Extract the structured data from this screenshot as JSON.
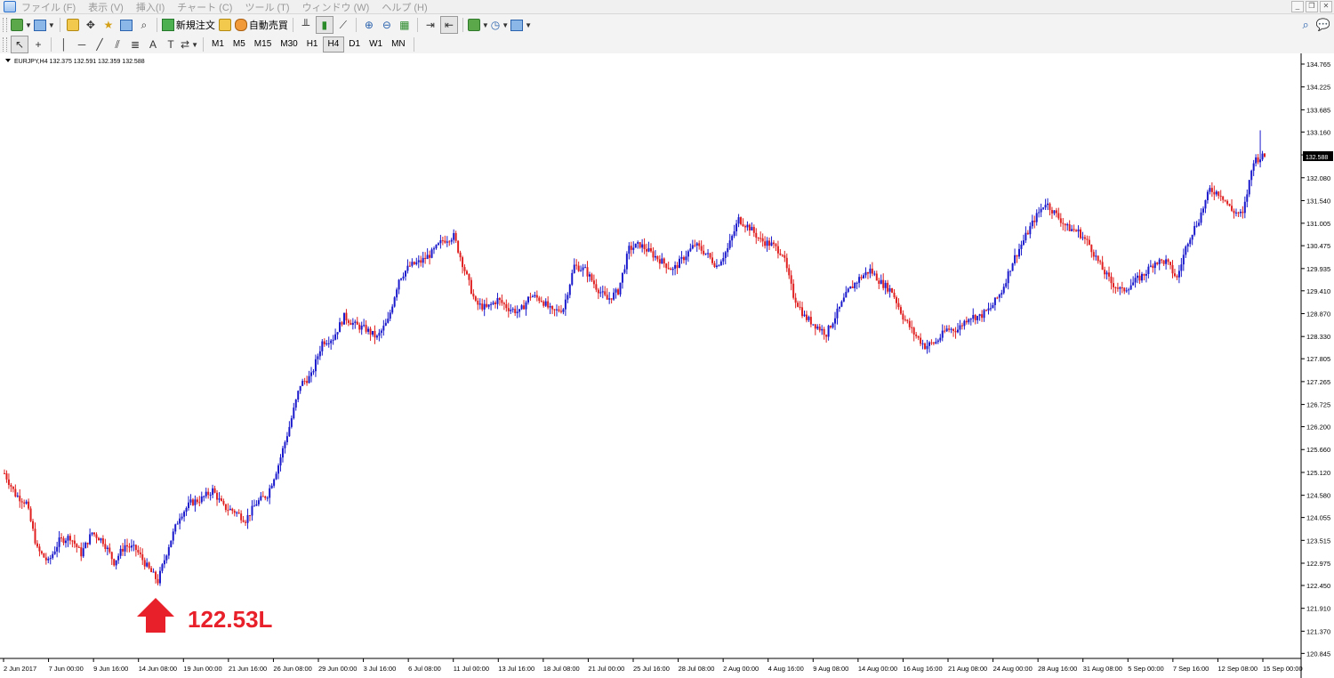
{
  "menu": {
    "items": [
      "ファイル (F)",
      "表示 (V)",
      "挿入(I)",
      "チャート (C)",
      "ツール (T)",
      "ウィンドウ (W)",
      "ヘルプ (H)"
    ]
  },
  "toolbar": {
    "new_order_label": "新規注文",
    "auto_trade_label": "自動売買"
  },
  "timeframes": [
    "M1",
    "M5",
    "M15",
    "M30",
    "H1",
    "H4",
    "D1",
    "W1",
    "MN"
  ],
  "active_timeframe": "H4",
  "chart_header": "EURJPY,H4  132.375 132.591 132.359 132.588",
  "current_price": "132.588",
  "price_labels": [
    "134.765",
    "134.225",
    "133.685",
    "133.160",
    "132.620",
    "132.080",
    "131.540",
    "131.005",
    "130.475",
    "129.935",
    "129.410",
    "128.870",
    "128.330",
    "127.805",
    "127.265",
    "126.725",
    "126.200",
    "125.660",
    "125.120",
    "124.580",
    "124.055",
    "123.515",
    "122.975",
    "122.450",
    "121.910",
    "121.370",
    "120.845"
  ],
  "time_labels": [
    "2 Jun 2017",
    "7 Jun 00:00",
    "9 Jun 16:00",
    "14 Jun 08:00",
    "19 Jun 00:00",
    "21 Jun 16:00",
    "26 Jun 08:00",
    "29 Jun 00:00",
    "3 Jul 16:00",
    "6 Jul 08:00",
    "11 Jul 00:00",
    "13 Jul 16:00",
    "18 Jul 08:00",
    "21 Jul 00:00",
    "25 Jul 16:00",
    "28 Jul 08:00",
    "2 Aug 00:00",
    "4 Aug 16:00",
    "9 Aug 08:00",
    "14 Aug 00:00",
    "16 Aug 16:00",
    "21 Aug 08:00",
    "24 Aug 00:00",
    "28 Aug 16:00",
    "31 Aug 08:00",
    "5 Sep 00:00",
    "7 Sep 16:00",
    "12 Sep 08:00",
    "15 Sep 00:00"
  ],
  "annotation": {
    "text": "122.53L",
    "color": "#e8202a"
  },
  "colors": {
    "bull": "#1a1acc",
    "bear": "#e02020",
    "accent": "#e8202a"
  },
  "chart_data": {
    "type": "candlestick",
    "symbol": "EURJPY",
    "timeframe": "H4",
    "ylim": [
      120.845,
      134.765
    ],
    "x_ticks": [
      "2 Jun 2017",
      "7 Jun 00:00",
      "9 Jun 16:00",
      "14 Jun 08:00",
      "19 Jun 00:00",
      "21 Jun 16:00",
      "26 Jun 08:00",
      "29 Jun 00:00",
      "3 Jul 16:00",
      "6 Jul 08:00",
      "11 Jul 00:00",
      "13 Jul 16:00",
      "18 Jul 08:00",
      "21 Jul 00:00",
      "25 Jul 16:00",
      "28 Jul 08:00",
      "2 Aug 00:00",
      "4 Aug 16:00",
      "9 Aug 08:00",
      "14 Aug 00:00",
      "16 Aug 16:00",
      "21 Aug 08:00",
      "24 Aug 00:00",
      "28 Aug 16:00",
      "31 Aug 08:00",
      "5 Sep 00:00",
      "7 Sep 16:00",
      "12 Sep 08:00",
      "15 Sep 00:00"
    ],
    "close_path": [
      125.1,
      124.6,
      124.4,
      123.3,
      123.0,
      123.5,
      123.6,
      123.2,
      123.7,
      123.5,
      123.0,
      123.4,
      123.3,
      122.9,
      122.55,
      123.4,
      124.1,
      124.4,
      124.5,
      124.7,
      124.3,
      124.2,
      124.0,
      124.4,
      124.6,
      125.3,
      126.2,
      127.2,
      127.4,
      128.2,
      128.3,
      128.8,
      128.6,
      128.5,
      128.3,
      128.7,
      129.7,
      130.0,
      130.1,
      130.3,
      130.6,
      130.7,
      129.9,
      129.1,
      129.0,
      129.2,
      129.0,
      128.9,
      129.3,
      129.2,
      128.9,
      129.0,
      130.0,
      129.9,
      129.5,
      129.2,
      129.4,
      130.4,
      130.5,
      130.3,
      130.1,
      129.9,
      130.2,
      130.5,
      130.3,
      130.0,
      130.4,
      131.1,
      130.9,
      130.6,
      130.5,
      130.3,
      129.3,
      128.8,
      128.6,
      128.4,
      128.9,
      129.4,
      129.7,
      129.9,
      129.6,
      129.4,
      128.8,
      128.4,
      128.1,
      128.2,
      128.5,
      128.5,
      128.8,
      128.8,
      129.0,
      129.4,
      130.1,
      130.6,
      131.1,
      131.5,
      131.2,
      130.9,
      130.8,
      130.5,
      130.0,
      129.6,
      129.4,
      129.6,
      129.8,
      130.1,
      130.1,
      129.7,
      130.6,
      131.1,
      131.8,
      131.7,
      131.3,
      131.2,
      132.5,
      132.588
    ],
    "low": 122.53,
    "high": 133.2,
    "last": 132.588
  }
}
